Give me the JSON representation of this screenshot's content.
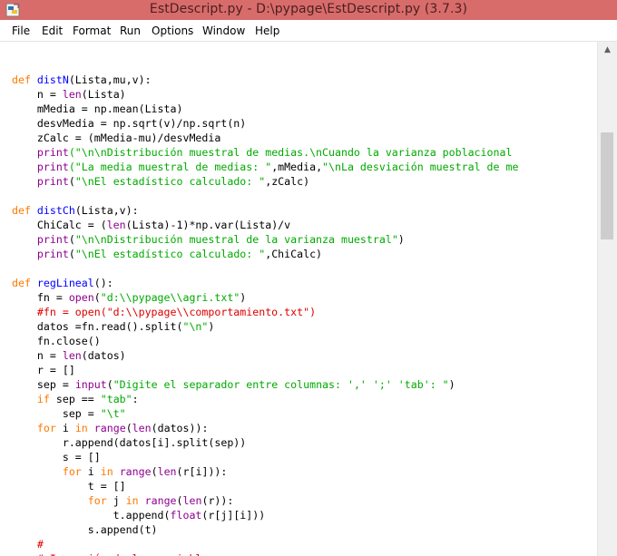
{
  "window": {
    "title": "EstDescript.py - D:\\pypage\\EstDescript.py (3.7.3)"
  },
  "menu": [
    "File",
    "Edit",
    "Format",
    "Run",
    "Options",
    "Window",
    "Help"
  ],
  "colors": {
    "titlebar": "#d86c6b",
    "keyword": "#ff7700",
    "builtin": "#900090",
    "string": "#00aa00",
    "definition": "#0000ff",
    "comment": "#dd0000"
  },
  "code": [
    [],
    [
      [
        "kw",
        "def "
      ],
      [
        "fn",
        "distN"
      ],
      [
        "",
        "(Lista,mu,v):"
      ]
    ],
    [
      [
        "",
        "    n = "
      ],
      [
        "bi",
        "len"
      ],
      [
        "",
        "(Lista)"
      ]
    ],
    [
      [
        "",
        "    mMedia = np.mean(Lista)"
      ]
    ],
    [
      [
        "",
        "    desvMedia = np.sqrt(v)/np.sqrt(n)"
      ]
    ],
    [
      [
        "",
        "    zCalc = (mMedia-mu)/desvMedia"
      ]
    ],
    [
      [
        "",
        "    "
      ],
      [
        "bi",
        "print"
      ],
      [
        "str",
        "(\"\\n\\nDistribución muestral de medias.\\nCuando la varianza poblacional"
      ]
    ],
    [
      [
        "",
        "    "
      ],
      [
        "bi",
        "print"
      ],
      [
        "str",
        "(\"La media muestral de medias: \""
      ],
      [
        "",
        ",mMedia,"
      ],
      [
        "str",
        "\"\\nLa desviación muestral de me"
      ]
    ],
    [
      [
        "",
        "    "
      ],
      [
        "bi",
        "print"
      ],
      [
        "",
        "("
      ],
      [
        "str",
        "\"\\nEl estadístico calculado: \""
      ],
      [
        "",
        ",zCalc)"
      ]
    ],
    [],
    [
      [
        "kw",
        "def "
      ],
      [
        "fn",
        "distCh"
      ],
      [
        "",
        "(Lista,v):"
      ]
    ],
    [
      [
        "",
        "    ChiCalc = ("
      ],
      [
        "bi",
        "len"
      ],
      [
        "",
        "(Lista)-1)*np.var(Lista)/v"
      ]
    ],
    [
      [
        "",
        "    "
      ],
      [
        "bi",
        "print"
      ],
      [
        "",
        "("
      ],
      [
        "str",
        "\"\\n\\nDistribución muestral de la varianza muestral\""
      ],
      [
        "",
        ")"
      ]
    ],
    [
      [
        "",
        "    "
      ],
      [
        "bi",
        "print"
      ],
      [
        "",
        "("
      ],
      [
        "str",
        "\"\\nEl estadístico calculado: \""
      ],
      [
        "",
        ",ChiCalc)"
      ]
    ],
    [],
    [
      [
        "kw",
        "def "
      ],
      [
        "fn",
        "regLineal"
      ],
      [
        "",
        "():"
      ]
    ],
    [
      [
        "",
        "    fn = "
      ],
      [
        "bi",
        "open"
      ],
      [
        "",
        "("
      ],
      [
        "str",
        "\"d:\\\\pypage\\\\agri.txt\""
      ],
      [
        "",
        ")"
      ]
    ],
    [
      [
        "",
        "    "
      ],
      [
        "cm",
        "#fn = open(\"d:\\\\pypage\\\\comportamiento.txt\")"
      ]
    ],
    [
      [
        "",
        "    datos =fn.read().split("
      ],
      [
        "str",
        "\"\\n\""
      ],
      [
        "",
        ")"
      ]
    ],
    [
      [
        "",
        "    fn.close()"
      ]
    ],
    [
      [
        "",
        "    n = "
      ],
      [
        "bi",
        "len"
      ],
      [
        "",
        "(datos)"
      ]
    ],
    [
      [
        "",
        "    r = []"
      ]
    ],
    [
      [
        "",
        "    sep = "
      ],
      [
        "bi",
        "input"
      ],
      [
        "",
        "("
      ],
      [
        "str",
        "\"Digite el separador entre columnas: ',' ';' 'tab': \""
      ],
      [
        "",
        ")"
      ]
    ],
    [
      [
        "",
        "    "
      ],
      [
        "kw",
        "if"
      ],
      [
        "",
        " sep == "
      ],
      [
        "str",
        "\"tab\""
      ],
      [
        "",
        ":"
      ]
    ],
    [
      [
        "",
        "        sep = "
      ],
      [
        "str",
        "\"\\t\""
      ]
    ],
    [
      [
        "",
        "    "
      ],
      [
        "kw",
        "for"
      ],
      [
        "",
        " i "
      ],
      [
        "kw",
        "in"
      ],
      [
        "",
        " "
      ],
      [
        "bi",
        "range"
      ],
      [
        "",
        "("
      ],
      [
        "bi",
        "len"
      ],
      [
        "",
        "(datos)):"
      ]
    ],
    [
      [
        "",
        "        r.append(datos[i].split(sep))"
      ]
    ],
    [
      [
        "",
        "        s = []"
      ]
    ],
    [
      [
        "",
        "        "
      ],
      [
        "kw",
        "for"
      ],
      [
        "",
        " i "
      ],
      [
        "kw",
        "in"
      ],
      [
        "",
        " "
      ],
      [
        "bi",
        "range"
      ],
      [
        "",
        "("
      ],
      [
        "bi",
        "len"
      ],
      [
        "",
        "(r[i])):"
      ]
    ],
    [
      [
        "",
        "            t = []"
      ]
    ],
    [
      [
        "",
        "            "
      ],
      [
        "kw",
        "for"
      ],
      [
        "",
        " j "
      ],
      [
        "kw",
        "in"
      ],
      [
        "",
        " "
      ],
      [
        "bi",
        "range"
      ],
      [
        "",
        "("
      ],
      [
        "bi",
        "len"
      ],
      [
        "",
        "(r)):"
      ]
    ],
    [
      [
        "",
        "                t.append("
      ],
      [
        "bi",
        "float"
      ],
      [
        "",
        "(r[j][i]))"
      ]
    ],
    [
      [
        "",
        "            s.append(t)"
      ]
    ],
    [
      [
        "",
        "    "
      ],
      [
        "cm",
        "#"
      ]
    ],
    [
      [
        "",
        "    "
      ],
      [
        "cm",
        "# Impresión de las variables"
      ]
    ],
    [
      [
        "",
        "    "
      ],
      [
        "cm",
        "#"
      ]
    ]
  ]
}
